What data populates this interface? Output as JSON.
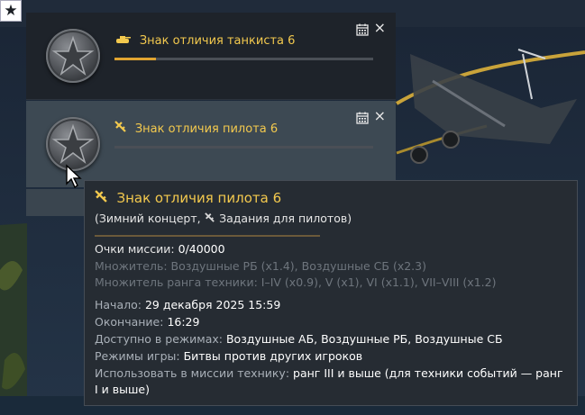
{
  "corner_button": {
    "icon": "star-icon",
    "glyph": "★"
  },
  "cards": [
    {
      "title": "Знак отличия танкиста 6",
      "type_icon": "tank-icon",
      "progress_fraction": 0.16,
      "progress_color": "#e0a431"
    },
    {
      "title": "Знак отличия пилота 6",
      "type_icon": "plane-icon",
      "progress_fraction": 0.0,
      "progress_color": "#e0a431"
    }
  ],
  "close_glyph": "×",
  "tooltip": {
    "title": "Знак отличия пилота 6",
    "subtitle_start": "(Зимний концерт,",
    "subtitle_end": "Задания для пилотов)",
    "mission_points_label": "Очки миссии:",
    "mission_points_value": "0/40000",
    "multiplier_line": "Множитель: Воздушные РБ (x1.4), Воздушные СБ (x2.3)",
    "rank_multiplier_line": "Множитель ранга техники: I–IV (x0.9), V (x1), VI (x1.1), VII–VIII (x1.2)",
    "start_label": "Начало:",
    "start_value": "29 декабря 2025 15:59",
    "end_label": "Окончание:",
    "end_value": "16:29",
    "modes_label": "Доступно в режимах:",
    "modes_value": "Воздушные АБ, Воздушные РБ, Воздушные СБ",
    "game_modes_label": "Режимы игры:",
    "game_modes_value": "Битвы против других игроков",
    "vehicles_label": "Использовать в миссии технику:",
    "vehicles_value": "ранг III и выше (для техники событий — ранг I и выше)"
  },
  "colors": {
    "accent_gold": "#f3c94e",
    "tooltip_bg": "#262c33",
    "card_active_bg": "#3d4953"
  }
}
